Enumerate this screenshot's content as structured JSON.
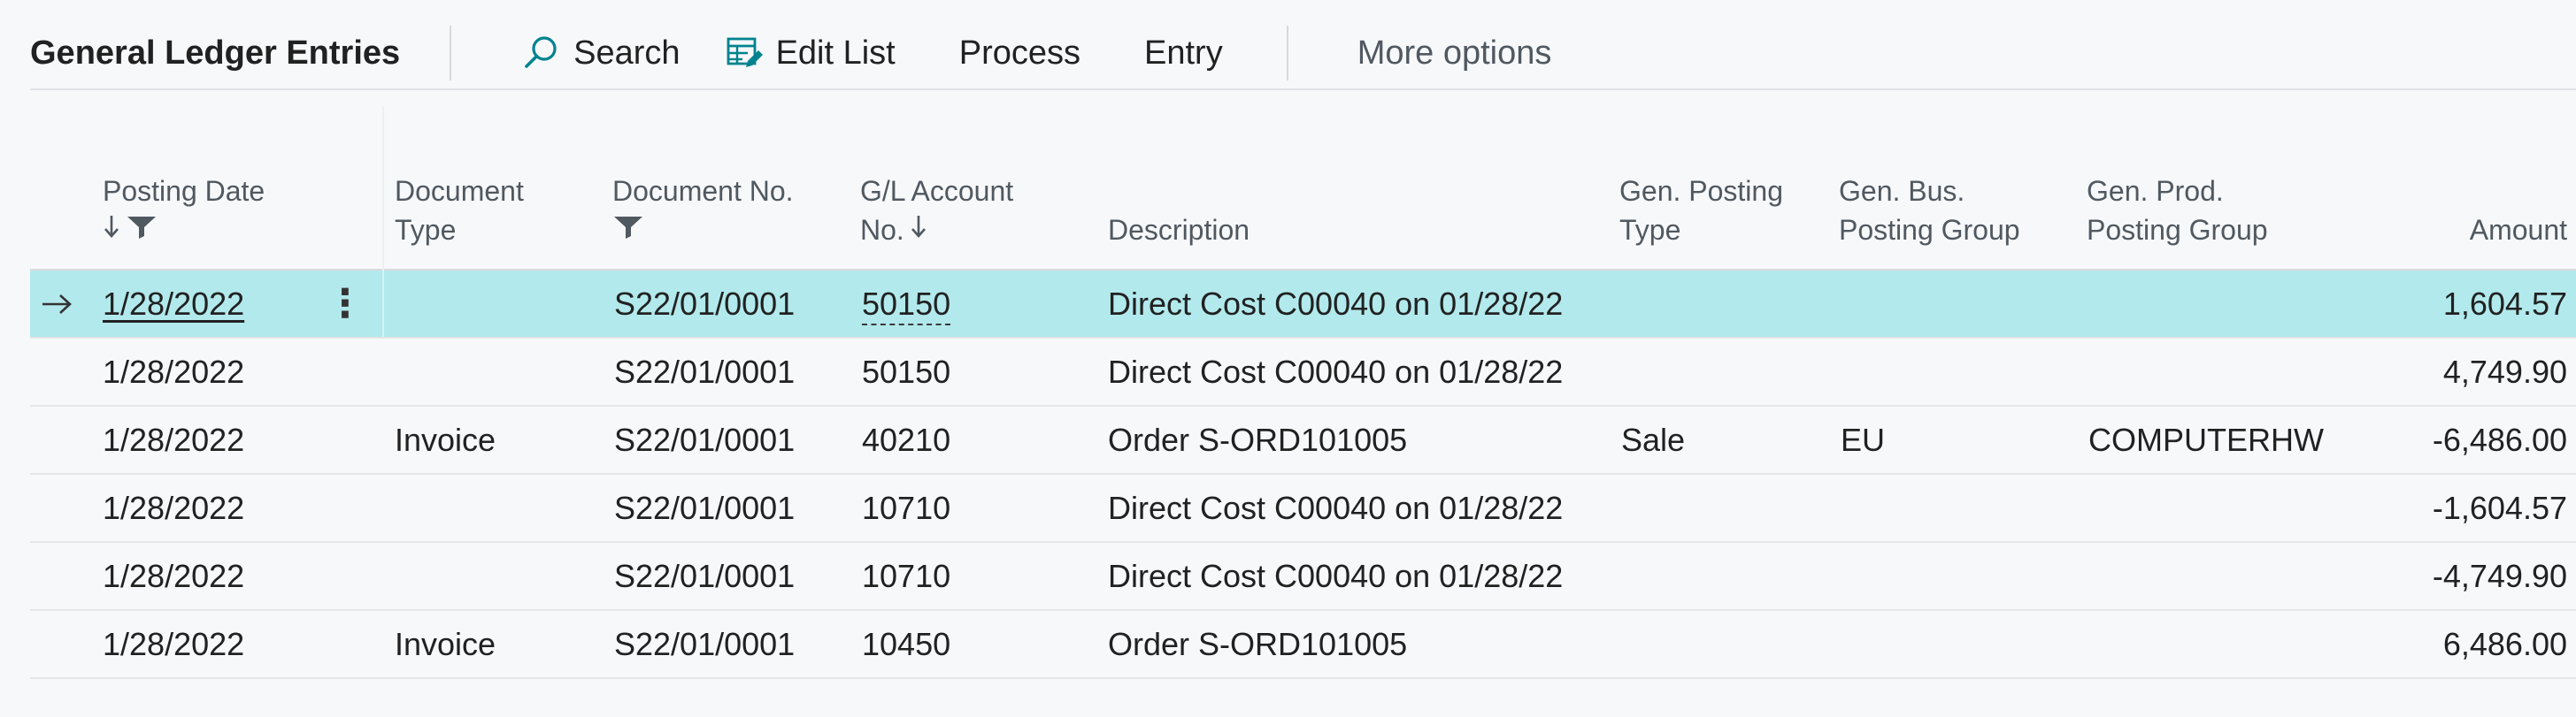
{
  "page": {
    "title": "General Ledger Entries"
  },
  "actions": {
    "search_label": "Search",
    "edit_list_label": "Edit List",
    "process_label": "Process",
    "entry_label": "Entry",
    "more_options_label": "More options"
  },
  "icons": {
    "search": "search-icon",
    "edit_list": "edit-list-icon",
    "row_arrow": "arrow-right-icon",
    "row_menu": "more-vertical-icon",
    "sort_down": "sort-down-icon",
    "filter": "filter-icon"
  },
  "colors": {
    "selected_row": "#b2e9ec",
    "accent": "#00838f"
  },
  "columns": {
    "posting_date": "Posting Date",
    "document_type_1": "Document",
    "document_type_2": "Type",
    "document_no": "Document No.",
    "gl_account_1": "G/L Account",
    "gl_account_2": "No.",
    "description": "Description",
    "gen_posting_type_1": "Gen. Posting",
    "gen_posting_type_2": "Type",
    "gen_bus_posting_group_1": "Gen. Bus.",
    "gen_bus_posting_group_2": "Posting Group",
    "gen_prod_posting_group_1": "Gen. Prod.",
    "gen_prod_posting_group_2": "Posting Group",
    "amount": "Amount"
  },
  "rows": [
    {
      "posting_date": "1/28/2022",
      "document_type": "",
      "document_no": "S22/01/0001",
      "gl_account_no": "50150",
      "description": "Direct Cost C00040 on 01/28/22",
      "gen_posting_type": "",
      "gen_bus_posting_group": "",
      "gen_prod_posting_group": "",
      "amount": "1,604.57"
    },
    {
      "posting_date": "1/28/2022",
      "document_type": "",
      "document_no": "S22/01/0001",
      "gl_account_no": "50150",
      "description": "Direct Cost C00040 on 01/28/22",
      "gen_posting_type": "",
      "gen_bus_posting_group": "",
      "gen_prod_posting_group": "",
      "amount": "4,749.90"
    },
    {
      "posting_date": "1/28/2022",
      "document_type": "Invoice",
      "document_no": "S22/01/0001",
      "gl_account_no": "40210",
      "description": "Order S-ORD101005",
      "gen_posting_type": "Sale",
      "gen_bus_posting_group": "EU",
      "gen_prod_posting_group": "COMPUTERHW",
      "amount": "-6,486.00"
    },
    {
      "posting_date": "1/28/2022",
      "document_type": "",
      "document_no": "S22/01/0001",
      "gl_account_no": "10710",
      "description": "Direct Cost C00040 on 01/28/22",
      "gen_posting_type": "",
      "gen_bus_posting_group": "",
      "gen_prod_posting_group": "",
      "amount": "-1,604.57"
    },
    {
      "posting_date": "1/28/2022",
      "document_type": "",
      "document_no": "S22/01/0001",
      "gl_account_no": "10710",
      "description": "Direct Cost C00040 on 01/28/22",
      "gen_posting_type": "",
      "gen_bus_posting_group": "",
      "gen_prod_posting_group": "",
      "amount": "-4,749.90"
    },
    {
      "posting_date": "1/28/2022",
      "document_type": "Invoice",
      "document_no": "S22/01/0001",
      "gl_account_no": "10450",
      "description": "Order S-ORD101005",
      "gen_posting_type": "",
      "gen_bus_posting_group": "",
      "gen_prod_posting_group": "",
      "amount": "6,486.00"
    }
  ]
}
